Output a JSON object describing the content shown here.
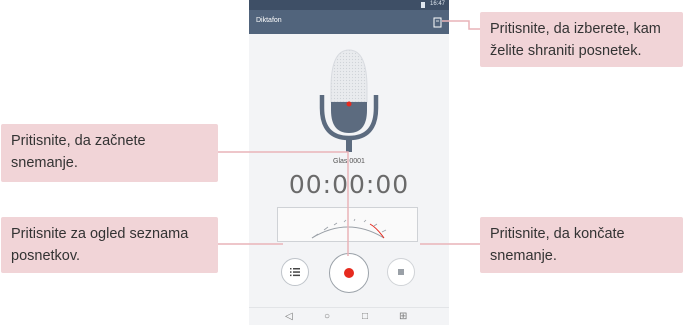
{
  "status": {
    "time": "16:47"
  },
  "app": {
    "title": "Diktafon"
  },
  "recording": {
    "name": "Glas 0001",
    "timer": "00:00:00"
  },
  "nav": {
    "back": "◁",
    "home": "○",
    "recent": "□",
    "split": "⊞"
  },
  "callouts": {
    "save_location": "Pritisnite, da izberete, kam želite shraniti posnetek.",
    "start_recording": "Pritisnite, da začnete snemanje.",
    "view_list": "Pritisnite za ogled seznama posnetkov.",
    "stop_recording": "Pritisnite, da končate snemanje."
  },
  "colors": {
    "appbar": "#51647c",
    "statusbar": "#3e4f66",
    "record_red": "#e62a1e",
    "callout_bg": "#f1d4d7",
    "leader_line": "#e9b3b8"
  },
  "icons": {
    "save": "storage-location-icon",
    "mic": "microphone-icon",
    "list": "list-icon",
    "record": "record-icon",
    "stop": "stop-icon"
  }
}
